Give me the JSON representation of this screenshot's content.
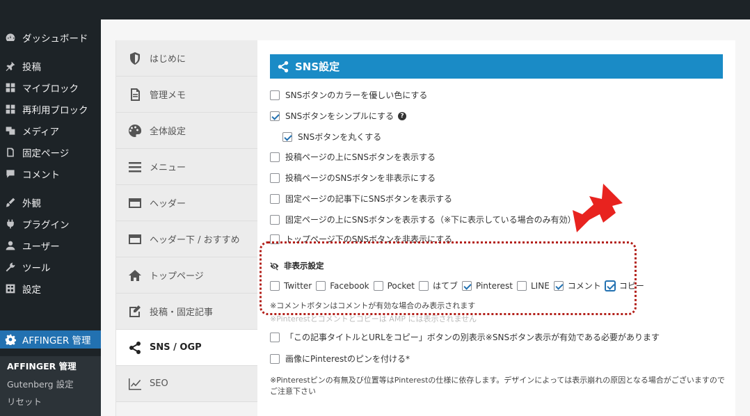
{
  "wp_menu": {
    "items": [
      {
        "label": "ダッシュボード",
        "icon": "dashboard-icon"
      },
      {
        "label": "投稿",
        "icon": "pin-icon"
      },
      {
        "label": "マイブロック",
        "icon": "blocks-icon"
      },
      {
        "label": "再利用ブロック",
        "icon": "blocks-icon"
      },
      {
        "label": "メディア",
        "icon": "media-icon"
      },
      {
        "label": "固定ページ",
        "icon": "page-icon"
      },
      {
        "label": "コメント",
        "icon": "comment-icon"
      },
      {
        "label": "外観",
        "icon": "brush-icon"
      },
      {
        "label": "プラグイン",
        "icon": "plugin-icon"
      },
      {
        "label": "ユーザー",
        "icon": "user-icon"
      },
      {
        "label": "ツール",
        "icon": "wrench-icon"
      },
      {
        "label": "設定",
        "icon": "settings-icon"
      },
      {
        "label": "AFFINGER 管理",
        "icon": "gear-icon"
      }
    ],
    "submenu": [
      "AFFINGER 管理",
      "Gutenberg 設定",
      "リセット"
    ]
  },
  "tabs": [
    {
      "label": "はじめに",
      "icon": "shield-icon"
    },
    {
      "label": "管理メモ",
      "icon": "memo-icon"
    },
    {
      "label": "全体設定",
      "icon": "palette-icon"
    },
    {
      "label": "メニュー",
      "icon": "menu-icon"
    },
    {
      "label": "ヘッダー",
      "icon": "header-icon"
    },
    {
      "label": "ヘッダー下 / おすすめ",
      "icon": "header-icon"
    },
    {
      "label": "トップページ",
      "icon": "home-icon"
    },
    {
      "label": "投稿・固定記事",
      "icon": "edit-icon"
    },
    {
      "label": "SNS / OGP",
      "icon": "share-icon"
    },
    {
      "label": "SEO",
      "icon": "chart-icon"
    }
  ],
  "section": {
    "title": "SNS設定",
    "options": [
      {
        "label": "SNSボタンのカラーを優しい色にする",
        "checked": false
      },
      {
        "label": "SNSボタンをシンプルにする",
        "checked": true,
        "help": "?"
      },
      {
        "label": "SNSボタンを丸くする",
        "checked": true
      },
      {
        "label": "投稿ページの上にSNSボタンを表示する",
        "checked": false
      },
      {
        "label": "投稿ページのSNSボタンを非表示にする",
        "checked": false
      },
      {
        "label": "固定ページの記事下にSNSボタンを表示する",
        "checked": false
      },
      {
        "label": "固定ページの上にSNSボタンを表示する（※下に表示している場合のみ有効）",
        "checked": false
      },
      {
        "label": "トップページ下のSNSボタンを非表示にする",
        "checked": false
      }
    ],
    "hide_title": "非表示設定",
    "sns_items": [
      {
        "label": "Twitter",
        "checked": false
      },
      {
        "label": "Facebook",
        "checked": false
      },
      {
        "label": "Pocket",
        "checked": false
      },
      {
        "label": "はてブ",
        "checked": false
      },
      {
        "label": "Pinterest",
        "checked": true
      },
      {
        "label": "LINE",
        "checked": false
      },
      {
        "label": "コメント",
        "checked": true
      },
      {
        "label": "コピー",
        "checked": true
      }
    ],
    "note_comment": "※コメントボタンはコメントが有効な場合のみ表示されます",
    "note_faded": "※Pinterestとコメントとコピーは AMP には表示されません",
    "copy_option": "「この記事タイトルとURLをコピー」ボタンの別表示※SNSボタン表示が有効である必要があります",
    "pinterest_option": "画像にPinterestのピンを付ける*",
    "pinterest_note_1": "※Pinterestピンの有無及び位置等はPinterestの仕様に依存します。デザインによっては表示崩れの原因となる場合がございますので",
    "pinterest_note_2": "ご注意下さい"
  },
  "colors": {
    "accent": "#1a8bc6",
    "wp_dark": "#1d2327",
    "wp_active": "#2271b1",
    "highlight": "#b3201a",
    "arrow": "#e8231f"
  }
}
